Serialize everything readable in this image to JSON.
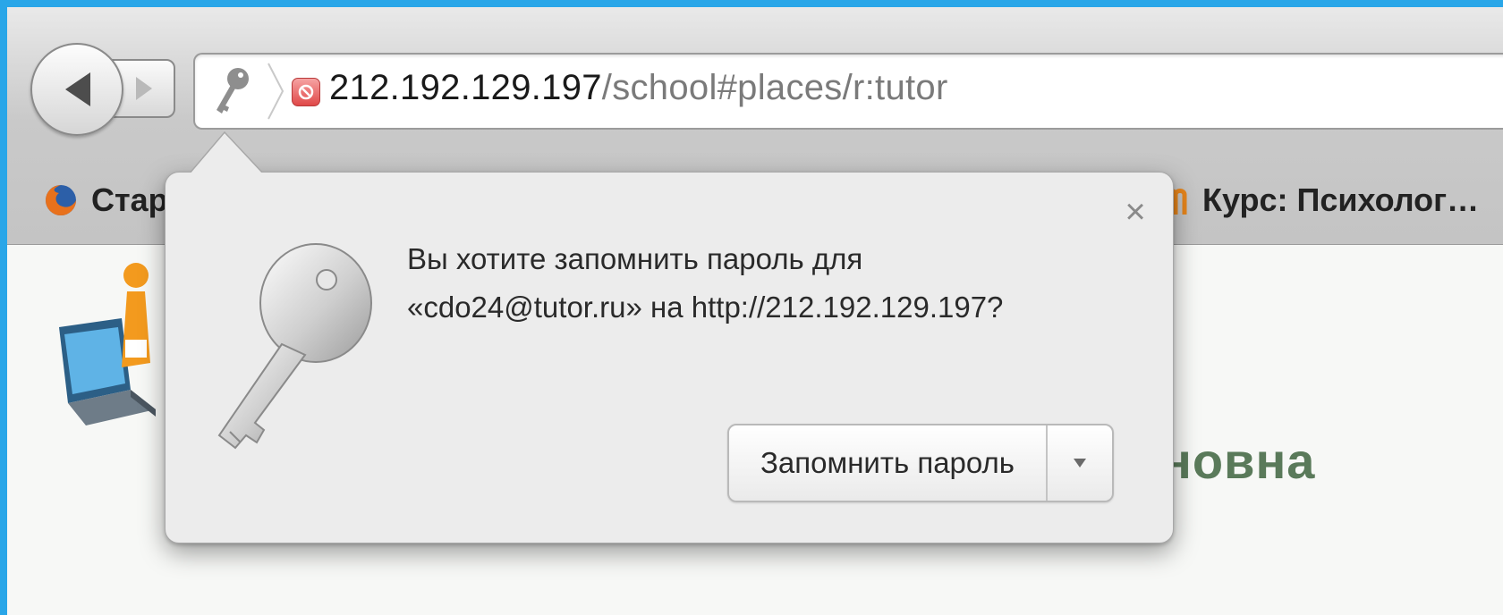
{
  "browser": {
    "back_icon": "back-arrow-icon",
    "forward_icon": "forward-arrow-icon",
    "address_bar": {
      "key_icon": "key-icon",
      "site_icon": "site-favicon-icon",
      "host": "212.192.129.197",
      "path": "/school#places/r:tutor"
    },
    "bookmarks": [
      {
        "label": "Стар",
        "icon": "firefox-icon"
      },
      {
        "label": "Курс: Психолог…",
        "icon": "moodle-icon"
      }
    ]
  },
  "page": {
    "name_fragment": "новна"
  },
  "password_popup": {
    "message_line1": "Вы хотите запомнить пароль для",
    "message_line2": "«cdo24@tutor.ru» на http://212.192.129.197?",
    "save_label": "Запомнить пароль",
    "close_symbol": "×",
    "dropdown_icon": "triangle-down-icon",
    "key_art_icon": "key-illustration-icon"
  },
  "colors": {
    "accent_border": "#29a6e8",
    "page_text": "#5a7a5a",
    "site_icon_red": "#e04848"
  }
}
